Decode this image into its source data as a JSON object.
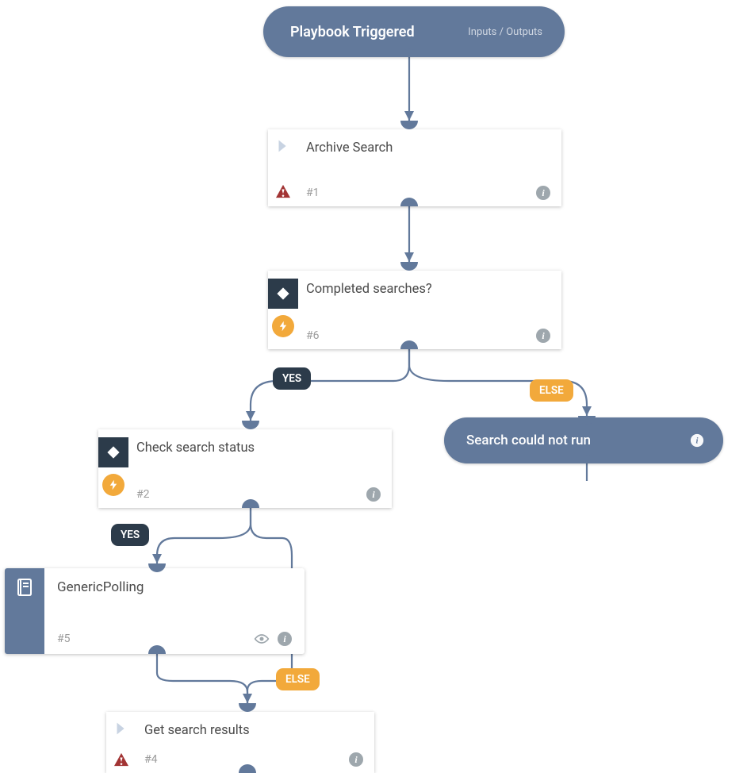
{
  "trigger": {
    "title": "Playbook Triggered",
    "io_label": "Inputs / Outputs"
  },
  "nodes": {
    "archive_search": {
      "title": "Archive Search",
      "number": "#1"
    },
    "completed_searches": {
      "title": "Completed searches?",
      "number": "#6"
    },
    "check_status": {
      "title": "Check search status",
      "number": "#2"
    },
    "generic_polling": {
      "title": "GenericPolling",
      "number": "#5"
    },
    "get_results": {
      "title": "Get search results",
      "number": "#4"
    },
    "search_fail": {
      "title": "Search could not run"
    }
  },
  "branches": {
    "yes": "YES",
    "else": "ELSE"
  }
}
